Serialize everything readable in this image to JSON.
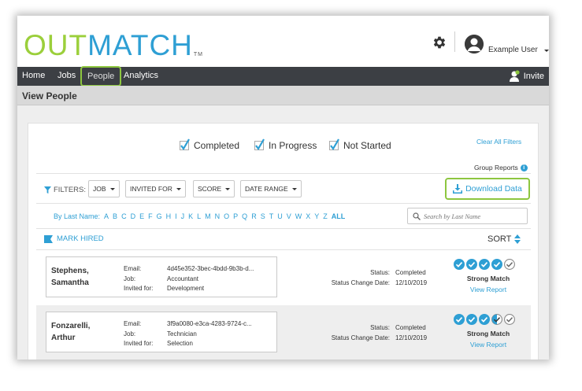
{
  "logo": {
    "part1": "OUT",
    "part2": "MATCH",
    "tm": "TM"
  },
  "user": {
    "name": "Example User"
  },
  "nav": {
    "items": [
      "Home",
      "Jobs",
      "People",
      "Analytics"
    ],
    "invite": "Invite"
  },
  "page": {
    "title": "View People"
  },
  "status_filters": [
    "Completed",
    "In Progress",
    "Not Started"
  ],
  "links": {
    "clear_filters": "Clear All Filters",
    "group_reports": "Group Reports"
  },
  "filters": {
    "label": "FILTERS:",
    "buttons": [
      "JOB",
      "INVITED FOR",
      "SCORE",
      "DATE RANGE"
    ],
    "download": "Download Data"
  },
  "alphabet": {
    "label": "By Last Name:",
    "letters": [
      "A",
      "B",
      "C",
      "D",
      "E",
      "F",
      "G",
      "H",
      "I",
      "J",
      "K",
      "L",
      "M",
      "N",
      "O",
      "P",
      "Q",
      "R",
      "S",
      "T",
      "U",
      "V",
      "W",
      "X",
      "Y",
      "Z"
    ],
    "all": "ALL"
  },
  "search": {
    "placeholder": "Search by Last Name"
  },
  "actions": {
    "mark_hired": "MARK HIRED",
    "sort": "SORT"
  },
  "field_labels": {
    "email": "Email:",
    "job": "Job:",
    "invited": "Invited for:",
    "status": "Status:",
    "status_date": "Status Change Date:"
  },
  "candidates": [
    {
      "last": "Stephens,",
      "first": "Samantha",
      "email": "4d45e352-3bec-4bdd-9b3b-d...",
      "job": "Accountant",
      "invited": "Development",
      "status": "Completed",
      "status_date": "12/10/2019",
      "match": "Strong Match",
      "view_report": "View Report",
      "score_icons": [
        "full",
        "full",
        "full",
        "full",
        "empty"
      ]
    },
    {
      "last": "Fonzarelli,",
      "first": "Arthur",
      "email": "3f9a0080-e3ca-4283-9724-c...",
      "job": "Technician",
      "invited": "Selection",
      "status": "Completed",
      "status_date": "12/10/2019",
      "match": "Strong Match",
      "view_report": "View Report",
      "score_icons": [
        "full",
        "full",
        "full",
        "half",
        "empty"
      ]
    }
  ],
  "colors": {
    "accent_blue": "#2e9fd4",
    "accent_green": "#8dc63f",
    "nav_bg": "#3c3f44"
  }
}
